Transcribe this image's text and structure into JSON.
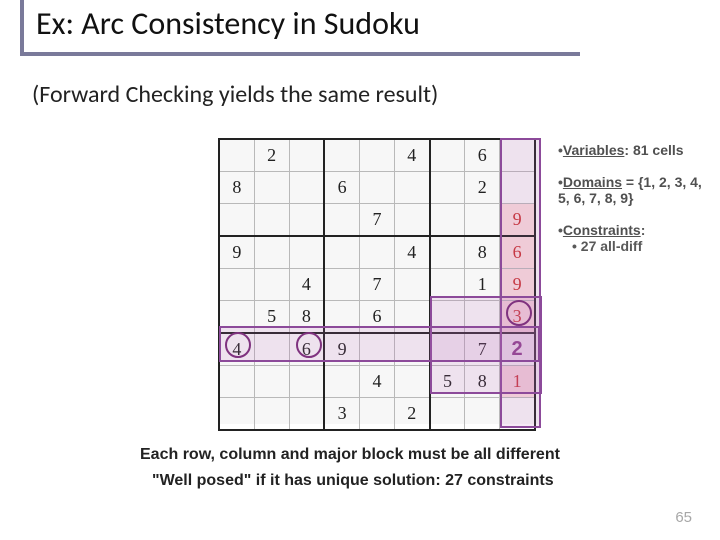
{
  "title": "Ex: Arc Consistency in Sudoku",
  "subtitle": "(Forward Checking yields the same result)",
  "notes": {
    "variables_label": "Variables",
    "variables_value": ": 81 cells",
    "domains_label": "Domains",
    "domains_value": " = {1, 2, 3, 4, 5, 6, 7, 8, 9}",
    "constraints_label": "Constraints",
    "constraints_item": " 27 all-diff"
  },
  "caption1": "Each row, column and major block must be all different",
  "caption2": "\"Well posed\" if it has unique solution: 27 constraints",
  "page_number": "65",
  "sudoku": {
    "rows": [
      [
        "",
        "2",
        "",
        "",
        "",
        "4",
        "",
        "6",
        ""
      ],
      [
        "8",
        "",
        "",
        "6",
        "",
        "",
        "",
        "2",
        ""
      ],
      [
        "",
        "",
        "",
        "",
        "7",
        "",
        "",
        "",
        "9"
      ],
      [
        "9",
        "",
        "",
        "",
        "",
        "4",
        "",
        "8",
        "6"
      ],
      [
        "",
        "",
        "4",
        "",
        "7",
        "",
        "",
        "1",
        "9"
      ],
      [
        "",
        "5",
        "8",
        "",
        "6",
        "",
        "",
        "",
        "3"
      ],
      [
        "4",
        "",
        "6",
        "9",
        "",
        "",
        "",
        "7",
        "2"
      ],
      [
        "",
        "",
        "",
        "",
        "4",
        "",
        "5",
        "8",
        "1"
      ],
      [
        "",
        "",
        "",
        "3",
        "",
        "2",
        "",
        "",
        ""
      ]
    ],
    "red_cells": [
      [
        5,
        8
      ],
      [
        2,
        8
      ],
      [
        3,
        8
      ],
      [
        4,
        8
      ],
      [
        7,
        8
      ],
      [
        8,
        8
      ]
    ],
    "special_cell": {
      "row": 6,
      "col": 8,
      "value": "2"
    }
  }
}
